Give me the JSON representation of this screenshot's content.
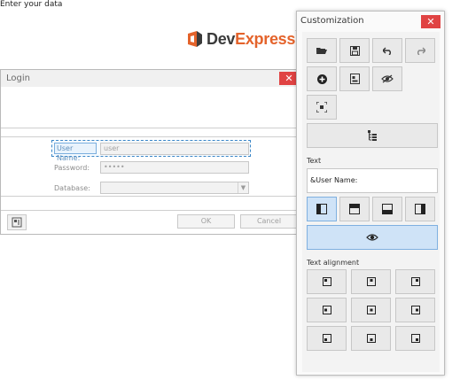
{
  "login": {
    "title": "Login",
    "close_glyph": "✕",
    "heading": "Enter your data",
    "logo": {
      "part1": "Dev",
      "part2": "Express",
      "tm": "™",
      "accent": "#e4632b",
      "icon": "devexpress-logo-icon"
    },
    "fields": {
      "username_label": "User Name:",
      "username_value": "user",
      "password_label": "Password:",
      "password_value": "•••••",
      "database_label": "Database:",
      "database_value": ""
    },
    "buttons": {
      "ok": "OK",
      "cancel": "Cancel"
    },
    "icons": [
      "layout-customize-icon",
      "chevron-down-icon"
    ]
  },
  "customization": {
    "title": "Customization",
    "close_glyph": "✕",
    "toolbar_icons": [
      "open-folder-icon",
      "save-icon",
      "undo-icon",
      "redo-icon",
      "add-item-icon",
      "layout-item-icon",
      "hide-icon",
      "fit-icon",
      "tree-view-icon"
    ],
    "text_section_label": "Text",
    "text_value": "&User Name:",
    "text_position_icons": [
      "text-left-icon",
      "text-top-icon",
      "text-bottom-icon",
      "text-right-icon"
    ],
    "text_visibility_icon": "visibility-icon",
    "alignment_section_label": "Text alignment",
    "alignment_icons": [
      "align-top-left-icon",
      "align-top-center-icon",
      "align-top-right-icon",
      "align-middle-left-icon",
      "align-middle-center-icon",
      "align-middle-right-icon",
      "align-bottom-left-icon",
      "align-bottom-center-icon",
      "align-bottom-right-icon"
    ],
    "colors": {
      "active_fill": "#cfe3f7",
      "active_border": "#7fb0e0",
      "close": "#e04343"
    }
  }
}
